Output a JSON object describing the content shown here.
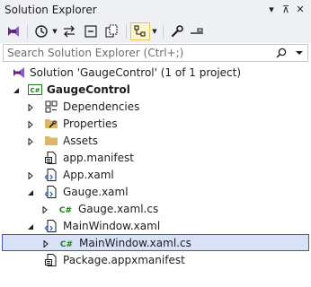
{
  "window": {
    "title": "Solution Explorer",
    "pin_glyph": "⊼",
    "close_glyph": "✕",
    "dropdown_glyph": "▾"
  },
  "toolbar": {
    "icons": [
      "vs-switch-views-icon",
      "history-icon",
      "sync-with-active-document-icon",
      "collapse-all-icon",
      "show-all-files-icon",
      "tracking-view-icon",
      "properties-wrench-icon",
      "preview-selected-icon"
    ]
  },
  "search": {
    "placeholder": "Search Solution Explorer (Ctrl+;)",
    "value": ""
  },
  "tree": {
    "solution": "Solution 'GaugeControl' (1 of 1 project)",
    "project": "GaugeControl",
    "project_badge": "C#",
    "dependencies": "Dependencies",
    "properties": "Properties",
    "assets": "Assets",
    "app_manifest": "app.manifest",
    "app_xaml": "App.xaml",
    "gauge_xaml": "Gauge.xaml",
    "gauge_xaml_cs": "Gauge.xaml.cs",
    "mainwindow_xaml": "MainWindow.xaml",
    "mainwindow_xaml_cs": "MainWindow.xaml.cs",
    "package_manifest": "Package.appxmanifest",
    "cs_badge": "C#"
  },
  "colors": {
    "accent": "#3a56c8",
    "selection": "#d9e1f7",
    "csharp_green": "#1e7a1e",
    "folder_yellow": "#dcb567",
    "panel_bg": "#eef0f4"
  }
}
